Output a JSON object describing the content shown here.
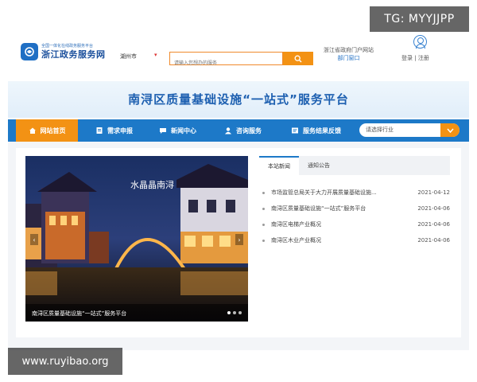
{
  "header": {
    "logo_sub": "全国一体化在线政务服务平台",
    "logo_main": "浙江政务服务网",
    "city": "湖州市",
    "search_placeholder": "请输入您想办的服务",
    "gov_link_line1": "浙江省政府门户网站",
    "gov_link_line2": "部门窗口",
    "auth": "登录 | 注册"
  },
  "banner_title": "南浔区质量基础设施“一站式”服务平台",
  "nav": {
    "items": [
      {
        "label": "网站首页",
        "icon": "home-icon",
        "active": true
      },
      {
        "label": "需求申报",
        "icon": "form-icon",
        "active": false
      },
      {
        "label": "新闻中心",
        "icon": "chat-icon",
        "active": false
      },
      {
        "label": "咨询服务",
        "icon": "service-icon",
        "active": false
      },
      {
        "label": "服务结果反馈",
        "icon": "feedback-icon",
        "active": false
      }
    ],
    "industry_select": "请选择行业"
  },
  "carousel": {
    "caption": "南浔区质量基础设施“一站式”服务平台",
    "calligraphy": "水晶晶南浔",
    "slides_count": 3,
    "active_slide": 1
  },
  "news": {
    "tabs": [
      "本站新闻",
      "通知公告"
    ],
    "items": [
      {
        "title": "市场监管总局关于大力开展质量基础设施...",
        "date": "2021-04-12"
      },
      {
        "title": "南浔区质量基础设施“一站式”服务平台",
        "date": "2021-04-06"
      },
      {
        "title": "南浔区电梯产业概况",
        "date": "2021-04-06"
      },
      {
        "title": "南浔区木业产业概况",
        "date": "2021-04-06"
      }
    ]
  },
  "watermarks": {
    "top": "TG: MYYJJPP",
    "bottom": "www.ruyibao.org"
  },
  "colors": {
    "nav_blue": "#1d79c8",
    "accent_orange": "#f39214",
    "title_blue": "#1c5fb0"
  }
}
